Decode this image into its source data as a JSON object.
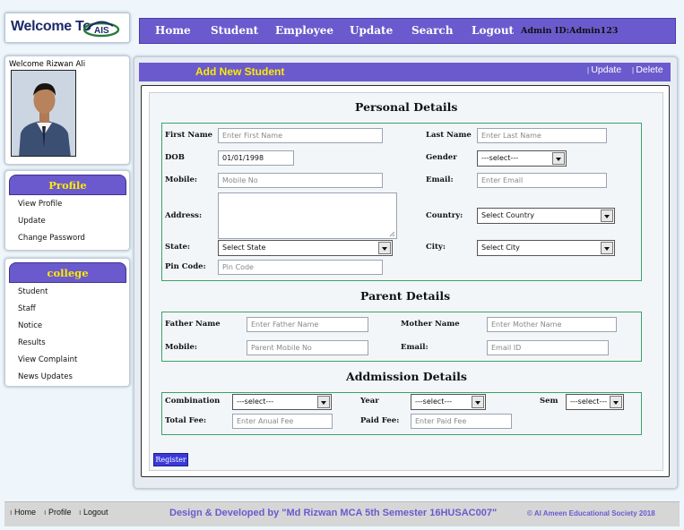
{
  "header": {
    "logo_text": "Welcome To",
    "logo_brand": "AIS",
    "nav": [
      "Home",
      "Student",
      "Employee",
      "Update",
      "Search",
      "Logout"
    ],
    "admin_id": "Admin ID:Admin123"
  },
  "sidebar": {
    "welcome": "Welcome Rizwan Ali",
    "profile": {
      "heading": "Profile",
      "items": [
        "View Profile",
        "Update",
        "Change Password"
      ]
    },
    "college": {
      "heading": "college",
      "items": [
        "Student",
        "Staff",
        "Notice",
        "Results",
        "View Complaint",
        "News Updates"
      ]
    }
  },
  "main": {
    "title": "Add New Student",
    "actions": [
      "Update",
      "Delete"
    ],
    "personal": {
      "heading": "Personal Details",
      "first_name": {
        "label": "First Name",
        "placeholder": "Enter First Name"
      },
      "last_name": {
        "label": "Last Name",
        "placeholder": "Enter Last Name"
      },
      "dob": {
        "label": "DOB",
        "value": "01/01/1998"
      },
      "gender": {
        "label": "Gender",
        "value": "---select---"
      },
      "mobile": {
        "label": "Mobile:",
        "placeholder": "Mobile No"
      },
      "email": {
        "label": "Email:",
        "placeholder": "Enter Email"
      },
      "address": {
        "label": "Address:"
      },
      "country": {
        "label": "Country:",
        "value": "Select Country"
      },
      "state": {
        "label": "State:",
        "value": "Select State"
      },
      "city": {
        "label": "City:",
        "value": "Select City"
      },
      "pin": {
        "label": "Pin Code:",
        "placeholder": "Pin Code"
      }
    },
    "parent": {
      "heading": "Parent Details",
      "father": {
        "label": "Father Name",
        "placeholder": "Enter Father Name"
      },
      "mother": {
        "label": "Mother Name",
        "placeholder": "Enter Mother Name"
      },
      "mobile": {
        "label": "Mobile:",
        "placeholder": "Parent Mobile No"
      },
      "email": {
        "label": "Email:",
        "placeholder": "Email ID"
      }
    },
    "admission": {
      "heading": "Addmission Details",
      "combination": {
        "label": "Combination",
        "value": "---select---"
      },
      "year": {
        "label": "Year",
        "value": "---select---"
      },
      "sem": {
        "label": "Sem",
        "value": "---select---"
      },
      "total_fee": {
        "label": "Total Fee:",
        "placeholder": "Enter Anual Fee"
      },
      "paid_fee": {
        "label": "Paid Fee:",
        "placeholder": "Enter Paid Fee"
      }
    },
    "register": "Register"
  },
  "footer": {
    "links": [
      "Home",
      "Profile",
      "Logout"
    ],
    "credit": "Design & Developed by \"Md Rizwan MCA 5th Semester 16HUSAC007\"",
    "copyright": "© Al Ameen Educational Society 2018"
  },
  "colors": {
    "accent": "#6a5acd",
    "title_text": "#ffea00",
    "group_border": "#3aa36a",
    "register": "#3a3ad8"
  }
}
